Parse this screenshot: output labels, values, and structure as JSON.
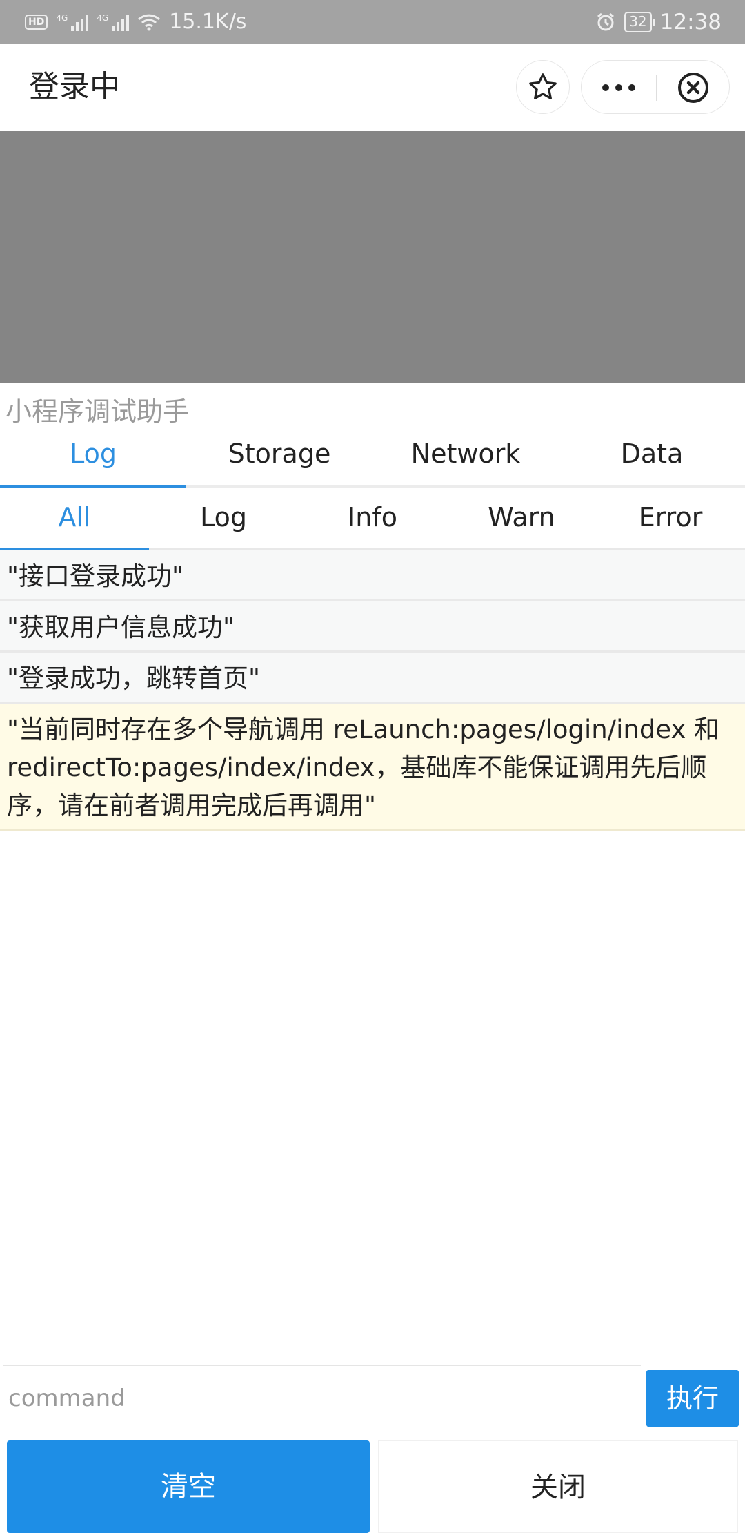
{
  "status_bar": {
    "hd_badge": "HD",
    "signal1_label": "4G",
    "signal2_label": "4G",
    "net_speed": "15.1K/s",
    "battery": "32",
    "time": "12:38"
  },
  "nav": {
    "title": "登录中"
  },
  "debug_panel": {
    "title": "小程序调试助手",
    "tabs": [
      {
        "label": "Log",
        "active": true
      },
      {
        "label": "Storage",
        "active": false
      },
      {
        "label": "Network",
        "active": false
      },
      {
        "label": "Data",
        "active": false
      }
    ],
    "subtabs": [
      {
        "label": "All",
        "active": true
      },
      {
        "label": "Log",
        "active": false
      },
      {
        "label": "Info",
        "active": false
      },
      {
        "label": "Warn",
        "active": false
      },
      {
        "label": "Error",
        "active": false
      }
    ],
    "logs": [
      {
        "level": "log",
        "text": "\"接口登录成功\""
      },
      {
        "level": "log",
        "text": "\"获取用户信息成功\""
      },
      {
        "level": "log",
        "text": "\"登录成功，跳转首页\""
      },
      {
        "level": "warn",
        "text": "\"当前同时存在多个导航调用 reLaunch:pages/login/index 和 redirectTo:pages/index/index，基础库不能保证调用先后顺序，请在前者调用完成后再调用\""
      }
    ],
    "command": {
      "placeholder": "command",
      "value": "",
      "execute_label": "执行"
    },
    "clear_label": "清空",
    "close_label": "关闭"
  },
  "colors": {
    "accent": "#1e8ee6",
    "tab_active": "#2d8fe0",
    "mask": "#858585",
    "warn_bg": "#fffbe6"
  }
}
